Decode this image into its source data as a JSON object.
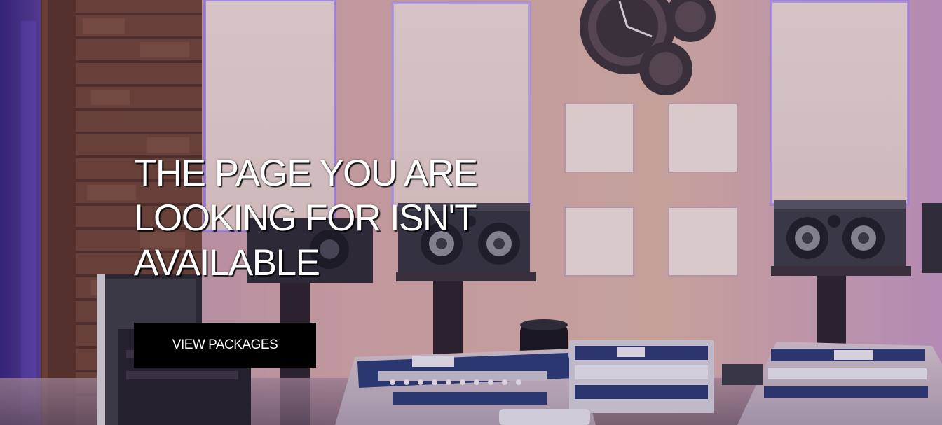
{
  "hero": {
    "headline_lines": [
      "THE PAGE YOU ARE",
      "LOOKING FOR ISN'T",
      "AVAILABLE"
    ],
    "cta_label": "VIEW PACKAGES",
    "background_image": "recording-studio-photo"
  },
  "colors": {
    "button_bg": "#000000",
    "text": "#ffffff",
    "wall": "#d9b6a8",
    "accent_light": "#8a5cff"
  }
}
